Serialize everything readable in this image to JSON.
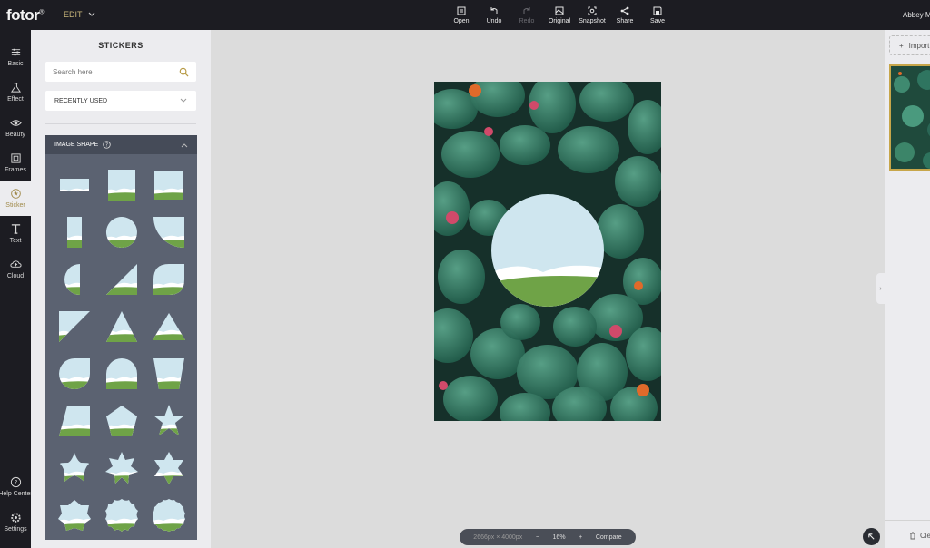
{
  "app": {
    "logo": "fotor",
    "logo_mark": "®",
    "mode": "EDIT",
    "user": "Abbey M"
  },
  "toolbar": [
    {
      "id": "open",
      "label": "Open",
      "icon": "open-icon",
      "enabled": true
    },
    {
      "id": "undo",
      "label": "Undo",
      "icon": "undo-icon",
      "enabled": true
    },
    {
      "id": "redo",
      "label": "Redo",
      "icon": "redo-icon",
      "enabled": false
    },
    {
      "id": "original",
      "label": "Original",
      "icon": "original-icon",
      "enabled": true
    },
    {
      "id": "snapshot",
      "label": "Snapshot",
      "icon": "snapshot-icon",
      "enabled": true
    },
    {
      "id": "share",
      "label": "Share",
      "icon": "share-icon",
      "enabled": true
    },
    {
      "id": "save",
      "label": "Save",
      "icon": "save-icon",
      "enabled": true
    }
  ],
  "leftnav": {
    "items": [
      {
        "id": "basic",
        "label": "Basic",
        "icon": "sliders-icon"
      },
      {
        "id": "effect",
        "label": "Effect",
        "icon": "flask-icon"
      },
      {
        "id": "beauty",
        "label": "Beauty",
        "icon": "eye-icon"
      },
      {
        "id": "frames",
        "label": "Frames",
        "icon": "frame-icon"
      },
      {
        "id": "sticker",
        "label": "Sticker",
        "icon": "sticker-icon",
        "active": true
      },
      {
        "id": "text",
        "label": "Text",
        "icon": "text-icon"
      },
      {
        "id": "cloud",
        "label": "Cloud",
        "icon": "cloud-icon"
      }
    ],
    "bottom": [
      {
        "id": "help",
        "label": "Help Center",
        "icon": "help-icon"
      },
      {
        "id": "settings",
        "label": "Settings",
        "icon": "gear-icon"
      }
    ]
  },
  "panel": {
    "title": "STICKERS",
    "search_placeholder": "Search here",
    "dropdown_value": "RECENTLY USED",
    "section_title": "IMAGE SHAPE"
  },
  "shapes": [
    "banner",
    "square-tall",
    "square",
    "rect-vertical",
    "circle",
    "quarter-round",
    "half-circle",
    "wedge",
    "leaf",
    "triangle-corner",
    "triangle",
    "triangle-wide",
    "rounded-drop",
    "rounded-top",
    "trapezoid",
    "trapezoid-tall",
    "pentagon",
    "star-5",
    "star-5-soft",
    "star-7",
    "star-6",
    "star-6-bold",
    "scallop",
    "scallop-round"
  ],
  "status": {
    "size": "2666px × 4000px",
    "zoom": "16%",
    "compare": "Compare",
    "minus": "−",
    "plus": "+"
  },
  "right": {
    "import_label": "Import",
    "clear_label": "Clear"
  },
  "colors": {
    "accent": "#c7a64a",
    "dark": "#1c1c22",
    "panel": "#ececef",
    "sky": "#cfe6ef",
    "grass": "#6fa347"
  }
}
